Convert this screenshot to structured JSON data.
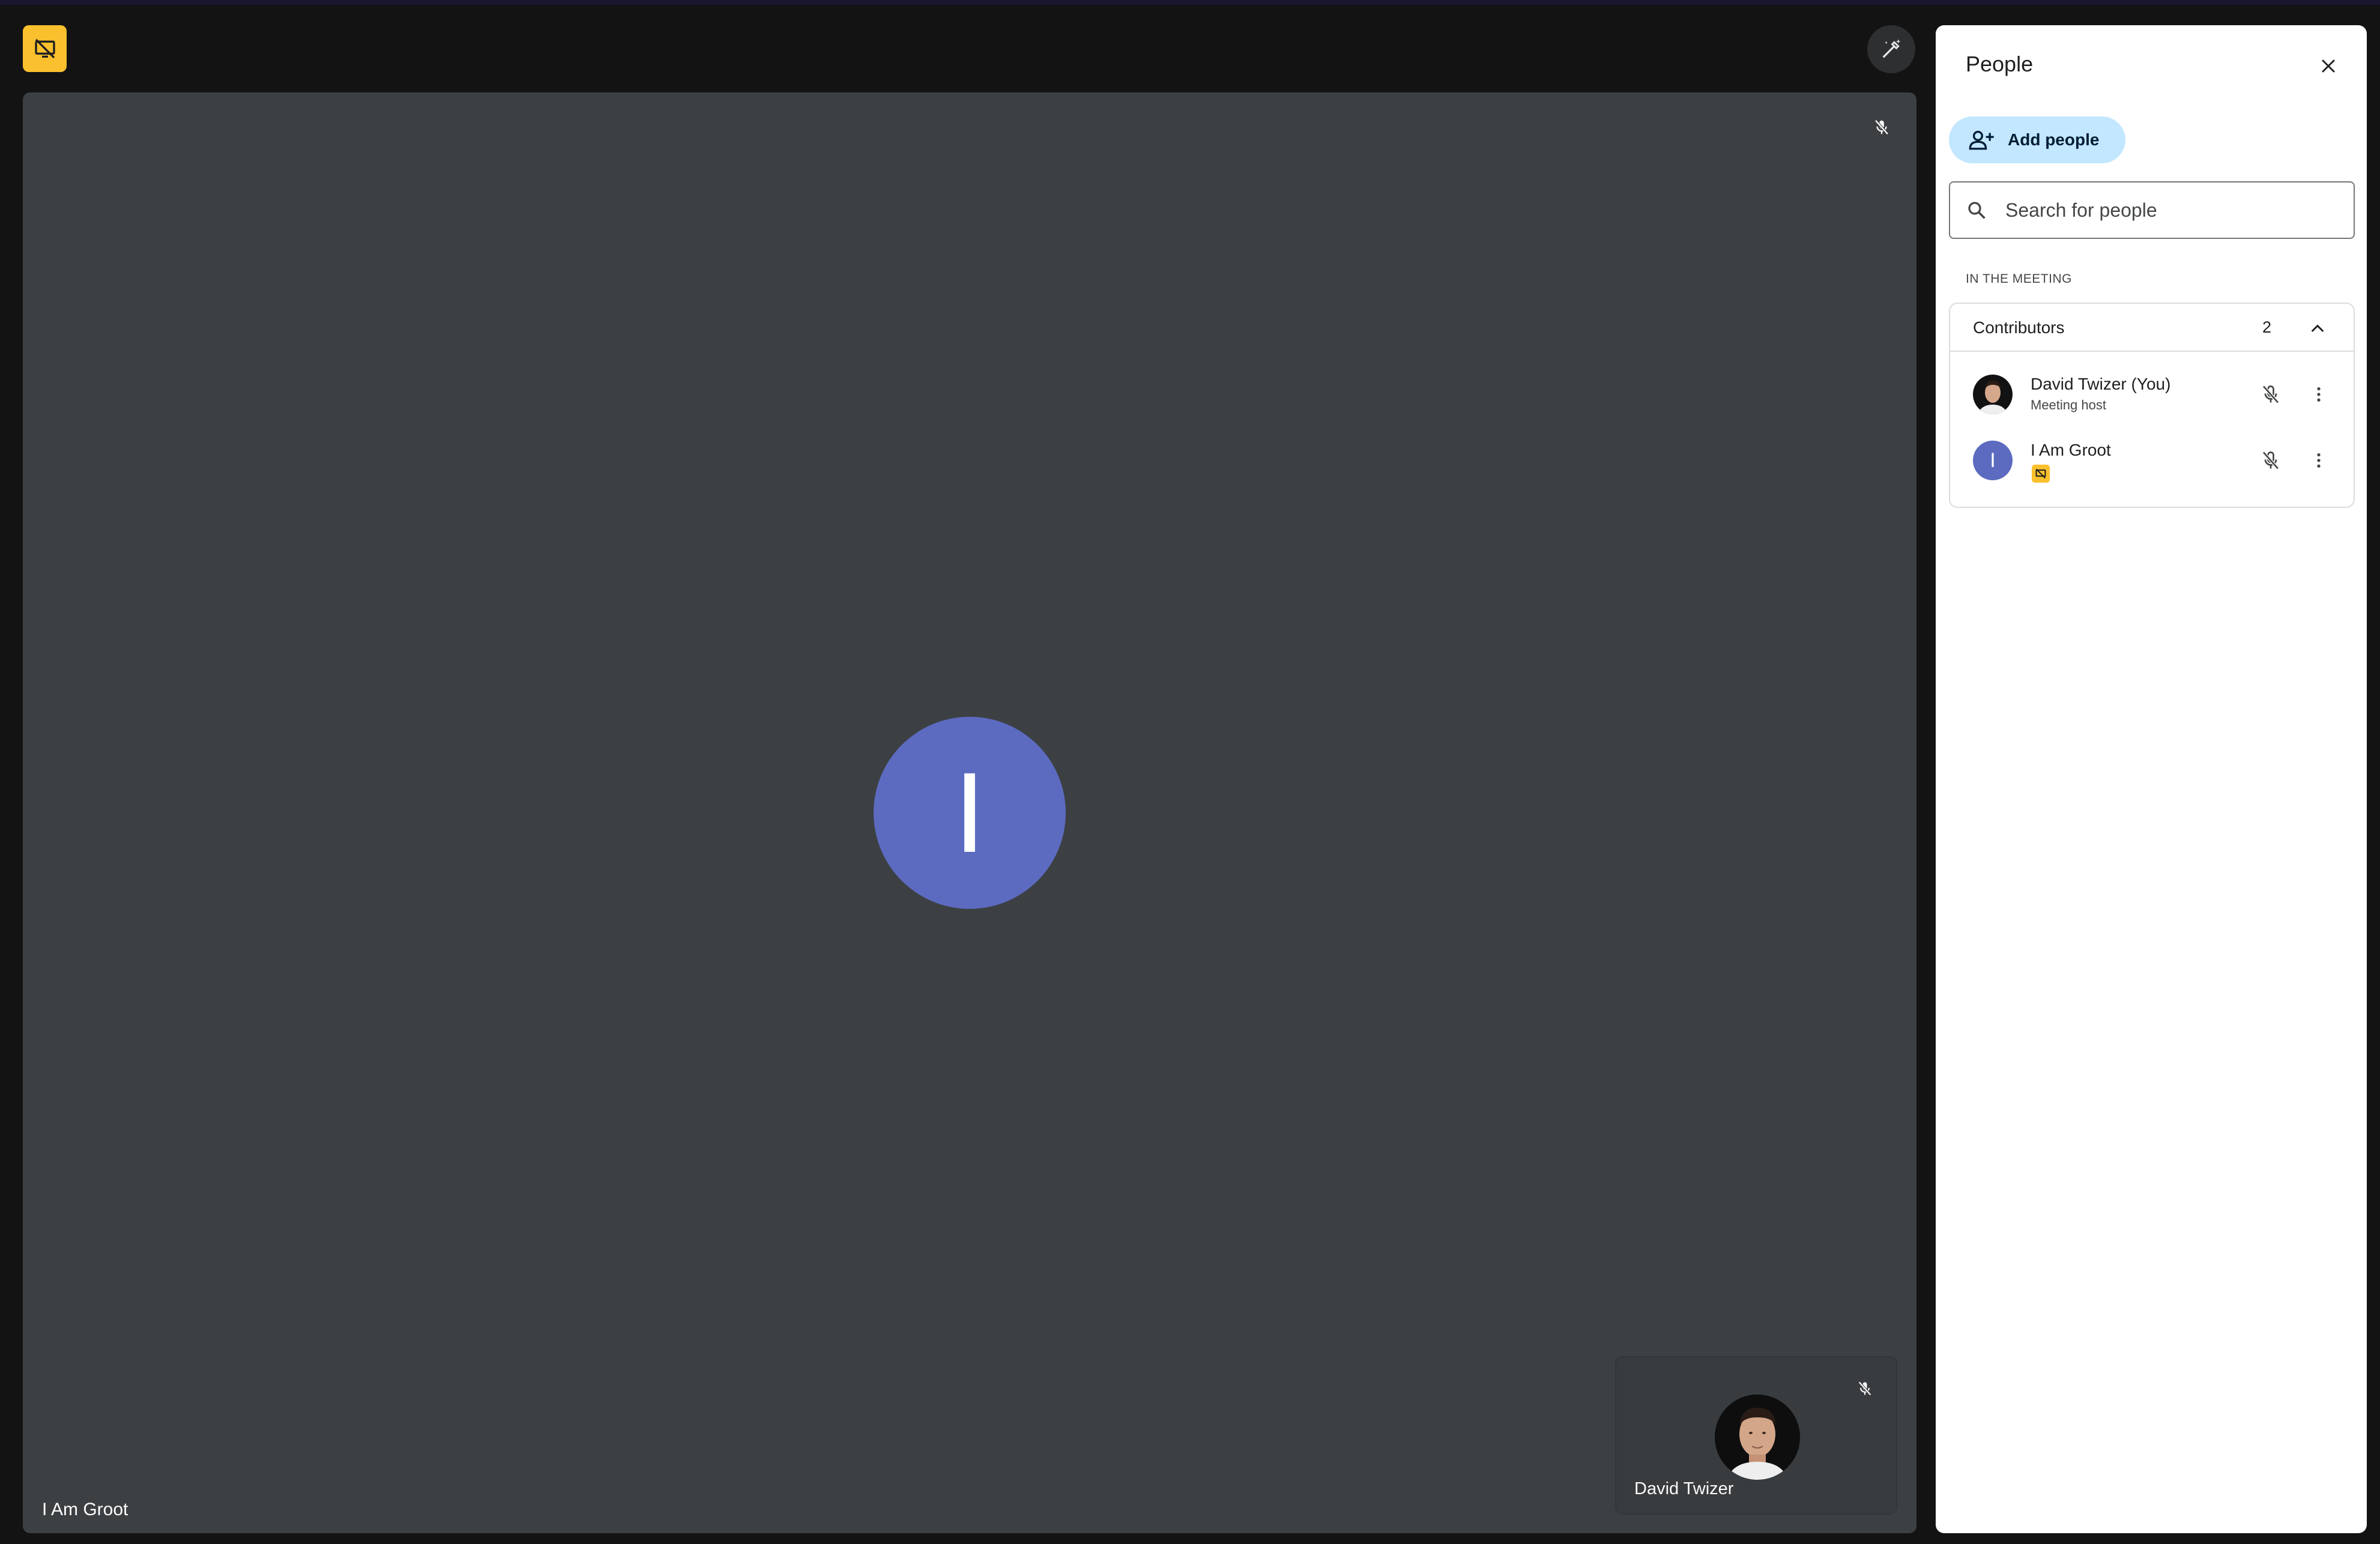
{
  "stage": {
    "presenting_icon": "presentation-off-icon",
    "effects_icon": "magic-pen-icon",
    "main_tile": {
      "participant_name": "I Am Groot",
      "avatar_letter": "I",
      "avatar_color": "#5c6bc0",
      "mic_state": "muted"
    },
    "self_tile": {
      "participant_name": "David Twizer",
      "mic_state": "muted"
    }
  },
  "people_panel": {
    "title": "People",
    "close_icon": "close-icon",
    "add_people_label": "Add people",
    "search_placeholder": "Search for people",
    "section_label": "IN THE MEETING",
    "group": {
      "title": "Contributors",
      "count": "2",
      "expanded": true
    },
    "participants": [
      {
        "name": "David Twizer (You)",
        "subtitle": "Meeting host",
        "avatar": "photo",
        "mic_state": "muted"
      },
      {
        "name": "I Am Groot",
        "subtitle": "",
        "avatar_letter": "I",
        "badge_icon": "presentation-off-icon",
        "mic_state": "muted"
      }
    ]
  },
  "colors": {
    "background": "#131314",
    "tile": "#3c4043",
    "accent_yellow": "#fbc02d",
    "add_button": "#c2e7ff",
    "avatar_purple": "#5c6bc0"
  }
}
